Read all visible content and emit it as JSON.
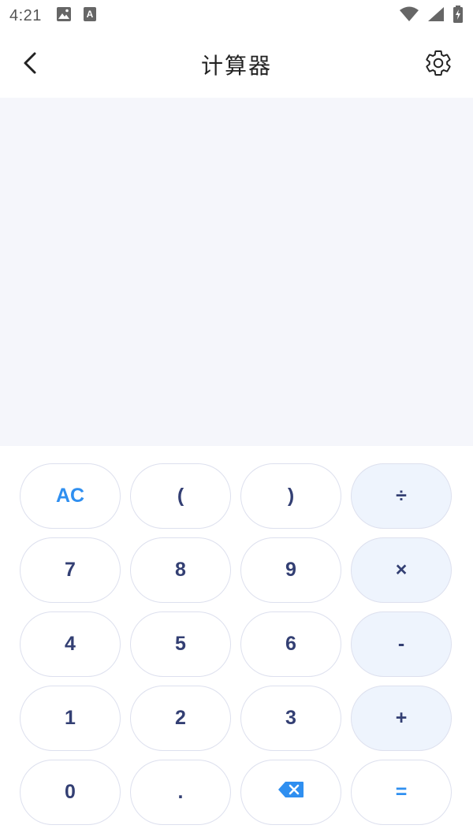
{
  "status": {
    "time": "4:21",
    "icons": [
      "image-icon",
      "a-badge-icon",
      "wifi-icon",
      "cell-signal-icon",
      "battery-charging-icon"
    ]
  },
  "app_bar": {
    "title": "计算器",
    "back_icon": "chevron-left-icon",
    "settings_icon": "gear-icon"
  },
  "display": {
    "expression": "",
    "result": ""
  },
  "keypad": {
    "rows": [
      [
        "AC",
        "(",
        ")",
        "÷"
      ],
      [
        "7",
        "8",
        "9",
        "×"
      ],
      [
        "4",
        "5",
        "6",
        "-"
      ],
      [
        "1",
        "2",
        "3",
        "+"
      ],
      [
        "0",
        ".",
        "backspace-icon",
        "="
      ]
    ]
  },
  "colors": {
    "accent": "#2f8ff0",
    "key_text": "#333f73",
    "operator_bg": "#eef4fd",
    "display_bg": "#f5f6fb",
    "key_border": "#dde0ee"
  }
}
